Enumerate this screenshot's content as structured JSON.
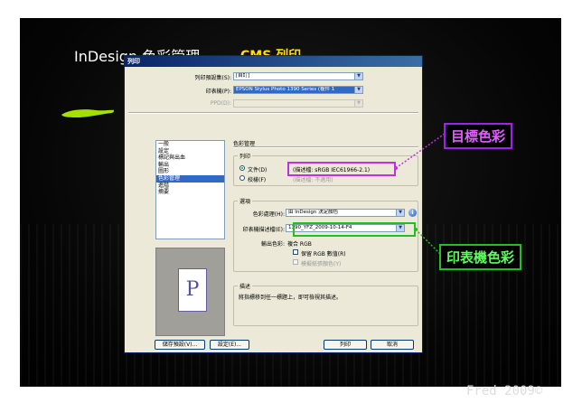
{
  "slide": {
    "title": "InDesign 色彩管理",
    "subtitle": "CMS 列印",
    "footer": "Fred 2009©",
    "annotation_target": "目標色彩",
    "annotation_printer": "印表機色彩"
  },
  "dialog": {
    "title": "列印",
    "preset_label": "列印預設集(S):",
    "preset_value": "[自訂]",
    "printer_label": "印表機(P):",
    "printer_value": "EPSON Stylus Photo 1390 Series (複件 1",
    "ppd_label": "PPD(D):",
    "categories": [
      "一般",
      "設定",
      "標記與出血",
      "輸出",
      "圖形",
      "色彩管理",
      "進階",
      "摘要"
    ],
    "selected_category": "色彩管理",
    "preview_letter": "P",
    "panel_title": "色彩管理",
    "print_group": {
      "label": "列印",
      "option_document": "文件(D)",
      "document_profile": "(描述檔: sRGB IEC61966-2.1)",
      "option_proof": "校樣(F)",
      "proof_profile": "(描述檔: 不適用)"
    },
    "options_group": {
      "label": "選項",
      "color_handling_label": "色彩處理(H):",
      "color_handling_value": "由 InDesign 決定顏色",
      "printer_profile_label": "印表機描述檔(E):",
      "printer_profile_value": "1390_YFZ_2009-10-14-F4",
      "output_color_label": "輸出色彩:",
      "output_color_value": "複合 RGB",
      "preserve_rgb": "保留 RGB 數值(R)",
      "simulate_paper": "模擬紙張顏色(Y)"
    },
    "description_group": {
      "label": "描述",
      "text": "將指標移到任一標題上，即可檢視其描述。"
    },
    "buttons": {
      "save_preset": "儲存預設(V)...",
      "setup": "設定(E)...",
      "print": "列印",
      "cancel": "取消"
    }
  },
  "colors": {
    "annotation_target": "#a020f0",
    "annotation_printer": "#20c020",
    "subtitle": "#ffe000",
    "selection": "#316ac5"
  }
}
